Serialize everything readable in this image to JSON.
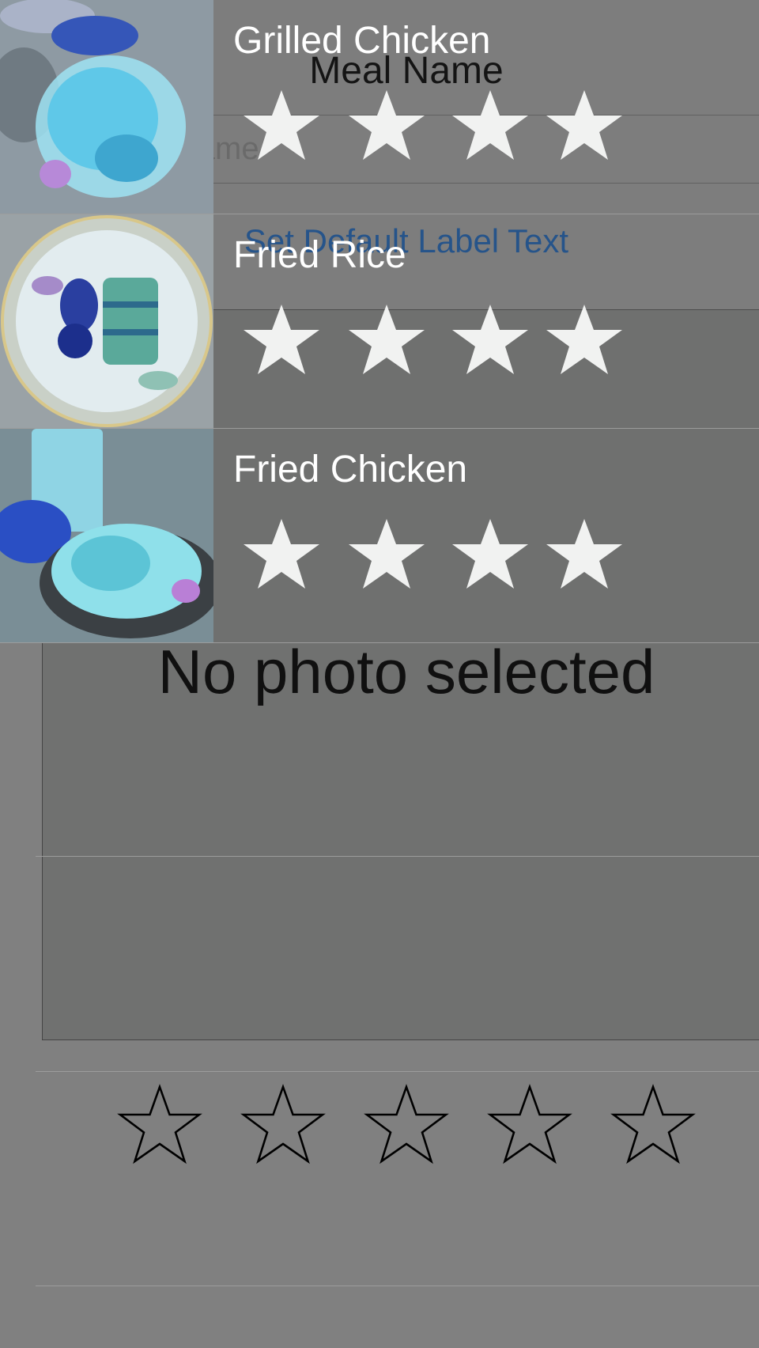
{
  "detail": {
    "title": "Meal Name",
    "meal_name_field": {
      "value": "",
      "placeholder": "Enter meal name"
    },
    "default_label_button": "Set Default Label Text",
    "photo_placeholder": "No photo selected",
    "rating": {
      "value": 0,
      "max": 5,
      "star_icon": "star-outline-icon"
    }
  },
  "meal_list": [
    {
      "name": "Grilled Chicken",
      "photo": "grilled-chicken-photo",
      "rating": 4
    },
    {
      "name": "Fried Rice",
      "photo": "fried-rice-photo",
      "rating": 4
    },
    {
      "name": "Fried Chicken",
      "photo": "fried-chicken-photo",
      "rating": 4
    }
  ],
  "colors": {
    "background": "#808080",
    "cell_text": "#ffffff",
    "link_blue": "#174f90",
    "filled_star": "#f1f2f1",
    "separator": "#9c9c9c"
  }
}
